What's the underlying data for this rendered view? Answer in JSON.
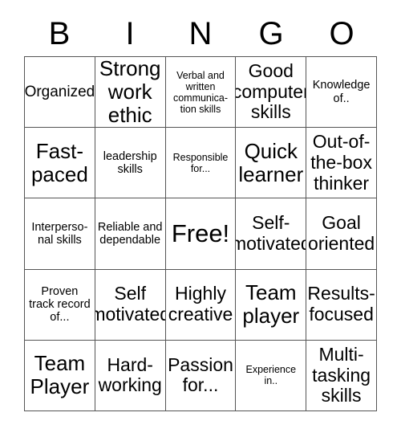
{
  "card": {
    "title_letters": [
      "B",
      "I",
      "N",
      "G",
      "O"
    ],
    "free_space_label": "Free!",
    "grid_line_color": "#555555",
    "text_color": "#000000",
    "background_color": "#ffffff",
    "rows": 5,
    "columns": 5,
    "cells": [
      [
        {
          "text": "Organized",
          "size": "md"
        },
        {
          "text": "Strong work ethic",
          "size": "xl"
        },
        {
          "text": "Verbal and written communica-tion skills",
          "size": "xs"
        },
        {
          "text": "Good computer skills",
          "size": "lg"
        },
        {
          "text": "Knowledge of..",
          "size": "sm"
        }
      ],
      [
        {
          "text": "Fast-paced",
          "size": "xl"
        },
        {
          "text": "leadership skills",
          "size": "sm"
        },
        {
          "text": "Responsible for...",
          "size": "xs"
        },
        {
          "text": "Quick learner",
          "size": "xl"
        },
        {
          "text": "Out-of-the-box thinker",
          "size": "lg"
        }
      ],
      [
        {
          "text": "Interperso-nal skills",
          "size": "sm"
        },
        {
          "text": "Reliable and dependable",
          "size": "sm"
        },
        {
          "text": "Free!",
          "size": "free"
        },
        {
          "text": "Self-motivated",
          "size": "lg"
        },
        {
          "text": "Goal oriented",
          "size": "lg"
        }
      ],
      [
        {
          "text": "Proven track record of...",
          "size": "sm"
        },
        {
          "text": "Self motivated",
          "size": "lg"
        },
        {
          "text": "Highly creative",
          "size": "lg"
        },
        {
          "text": "Team player",
          "size": "xl"
        },
        {
          "text": "Results-focused",
          "size": "lg"
        }
      ],
      [
        {
          "text": "Team Player",
          "size": "xl"
        },
        {
          "text": "Hard-working",
          "size": "lg"
        },
        {
          "text": "Passion for...",
          "size": "lg"
        },
        {
          "text": "Experience in..",
          "size": "xs"
        },
        {
          "text": "Multi-tasking skills",
          "size": "lg"
        }
      ]
    ]
  }
}
